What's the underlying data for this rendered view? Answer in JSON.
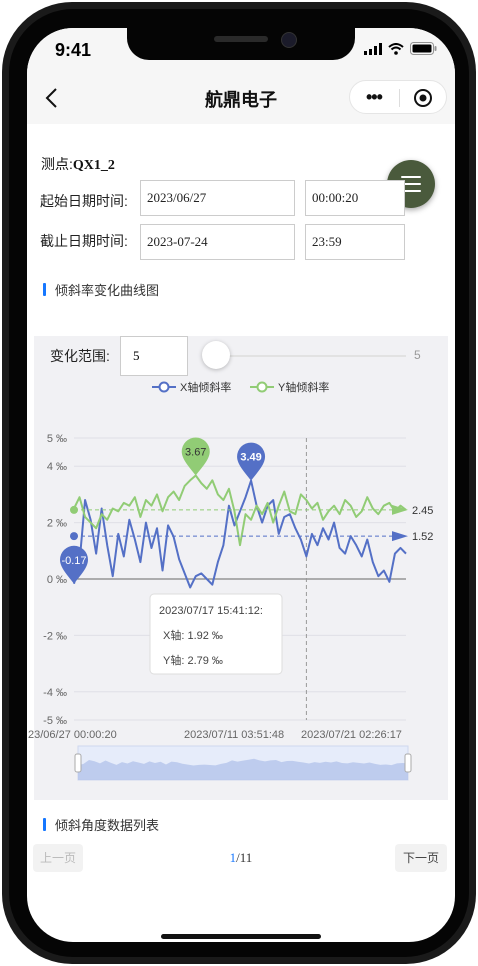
{
  "status_bar": {
    "time": "9:41"
  },
  "navbar": {
    "title": "航鼎电子"
  },
  "form": {
    "point_label": "测点:",
    "point_value": "QX1_2",
    "start_label": "起始日期时间:",
    "start_date": "2023/06/27",
    "start_time": "00:00:20",
    "end_label": "截止日期时间:",
    "end_date": "2023-07-24",
    "end_time": "23:59"
  },
  "chart_section": {
    "title": "倾斜率变化曲线图",
    "range_label": "变化范围:",
    "range_value": "5",
    "slider_value": "5"
  },
  "colors": {
    "x_series": "#5470c6",
    "y_series": "#91cc75",
    "accent": "#1677ff"
  },
  "chart_data": {
    "type": "line",
    "legend_position": "top-center",
    "series": [
      {
        "name": "X轴倾斜率",
        "color": "#5470c6",
        "values": [
          -0.17,
          0.6,
          2.8,
          2.1,
          0.9,
          2.5,
          1.2,
          0.1,
          1.6,
          0.8,
          2.1,
          1.4,
          0.6,
          2.0,
          1.1,
          1.8,
          0.3,
          1.9,
          1.5,
          0.7,
          0.2,
          -0.3,
          0.1,
          0.2,
          0.0,
          -0.2,
          0.6,
          1.2,
          2.6,
          1.9,
          2.4,
          2.9,
          3.49,
          2.6,
          2.0,
          2.6,
          2.8,
          1.6,
          2.2,
          2.3,
          1.8,
          1.4,
          0.8,
          1.6,
          1.2,
          1.8,
          1.4,
          2.0,
          1.1,
          0.9,
          1.52,
          1.2,
          0.8,
          1.4,
          0.6,
          0.1,
          0.3,
          -0.1,
          0.9,
          1.1,
          0.9
        ]
      },
      {
        "name": "Y轴倾斜率",
        "color": "#91cc75",
        "values": [
          2.5,
          2.9,
          2.2,
          2.0,
          1.8,
          2.3,
          2.1,
          2.5,
          2.4,
          2.7,
          2.6,
          2.9,
          2.2,
          2.8,
          2.6,
          3.0,
          2.4,
          2.9,
          3.1,
          2.8,
          3.3,
          3.5,
          3.67,
          3.4,
          3.2,
          3.5,
          3.0,
          2.8,
          3.2,
          2.4,
          1.2,
          2.3,
          2.1,
          2.6,
          2.3,
          2.7,
          2.0,
          2.6,
          3.1,
          2.4,
          2.3,
          3.0,
          2.8,
          2.5,
          2.7,
          2.1,
          2.4,
          2.6,
          2.3,
          2.8,
          2.6,
          2.2,
          2.4,
          2.9,
          2.5,
          2.3,
          2.6,
          2.7,
          2.4,
          2.6,
          2.45
        ]
      }
    ],
    "y_axis": {
      "ylim": [
        -5,
        5
      ],
      "ticks": [
        5,
        4,
        2,
        0,
        -2,
        -4,
        -5
      ],
      "tick_labels": [
        "5 ‰",
        "4 ‰",
        "2 ‰",
        "0 ‰",
        "-2 ‰",
        "-4 ‰",
        "-5 ‰"
      ]
    },
    "x_axis": {
      "tick_labels": [
        "23/06/27 00:00:20",
        "2023/07/11 03:51:48",
        "2023/07/21 02:26:17"
      ]
    },
    "mark_points": [
      {
        "series": "Y轴倾斜率",
        "label": "3.67",
        "value": 3.67
      },
      {
        "series": "X轴倾斜率",
        "label": "3.49",
        "value": 3.49
      },
      {
        "series": "X轴倾斜率",
        "label": "-0.17",
        "value": -0.17
      }
    ],
    "mark_lines": [
      {
        "series": "Y轴倾斜率",
        "label": "2.45",
        "value": 2.45
      },
      {
        "series": "X轴倾斜率",
        "label": "1.52",
        "value": 1.52
      }
    ],
    "tooltip": {
      "time": "2023/07/17 15:41:12:",
      "x_line": "X轴: 1.92 ‰",
      "y_line": "Y轴: 2.79 ‰"
    },
    "grid": true
  },
  "table_section": {
    "title": "倾斜角度数据列表"
  },
  "pager": {
    "prev": "上一页",
    "current": "1",
    "total": "/11",
    "next": "下一页"
  }
}
